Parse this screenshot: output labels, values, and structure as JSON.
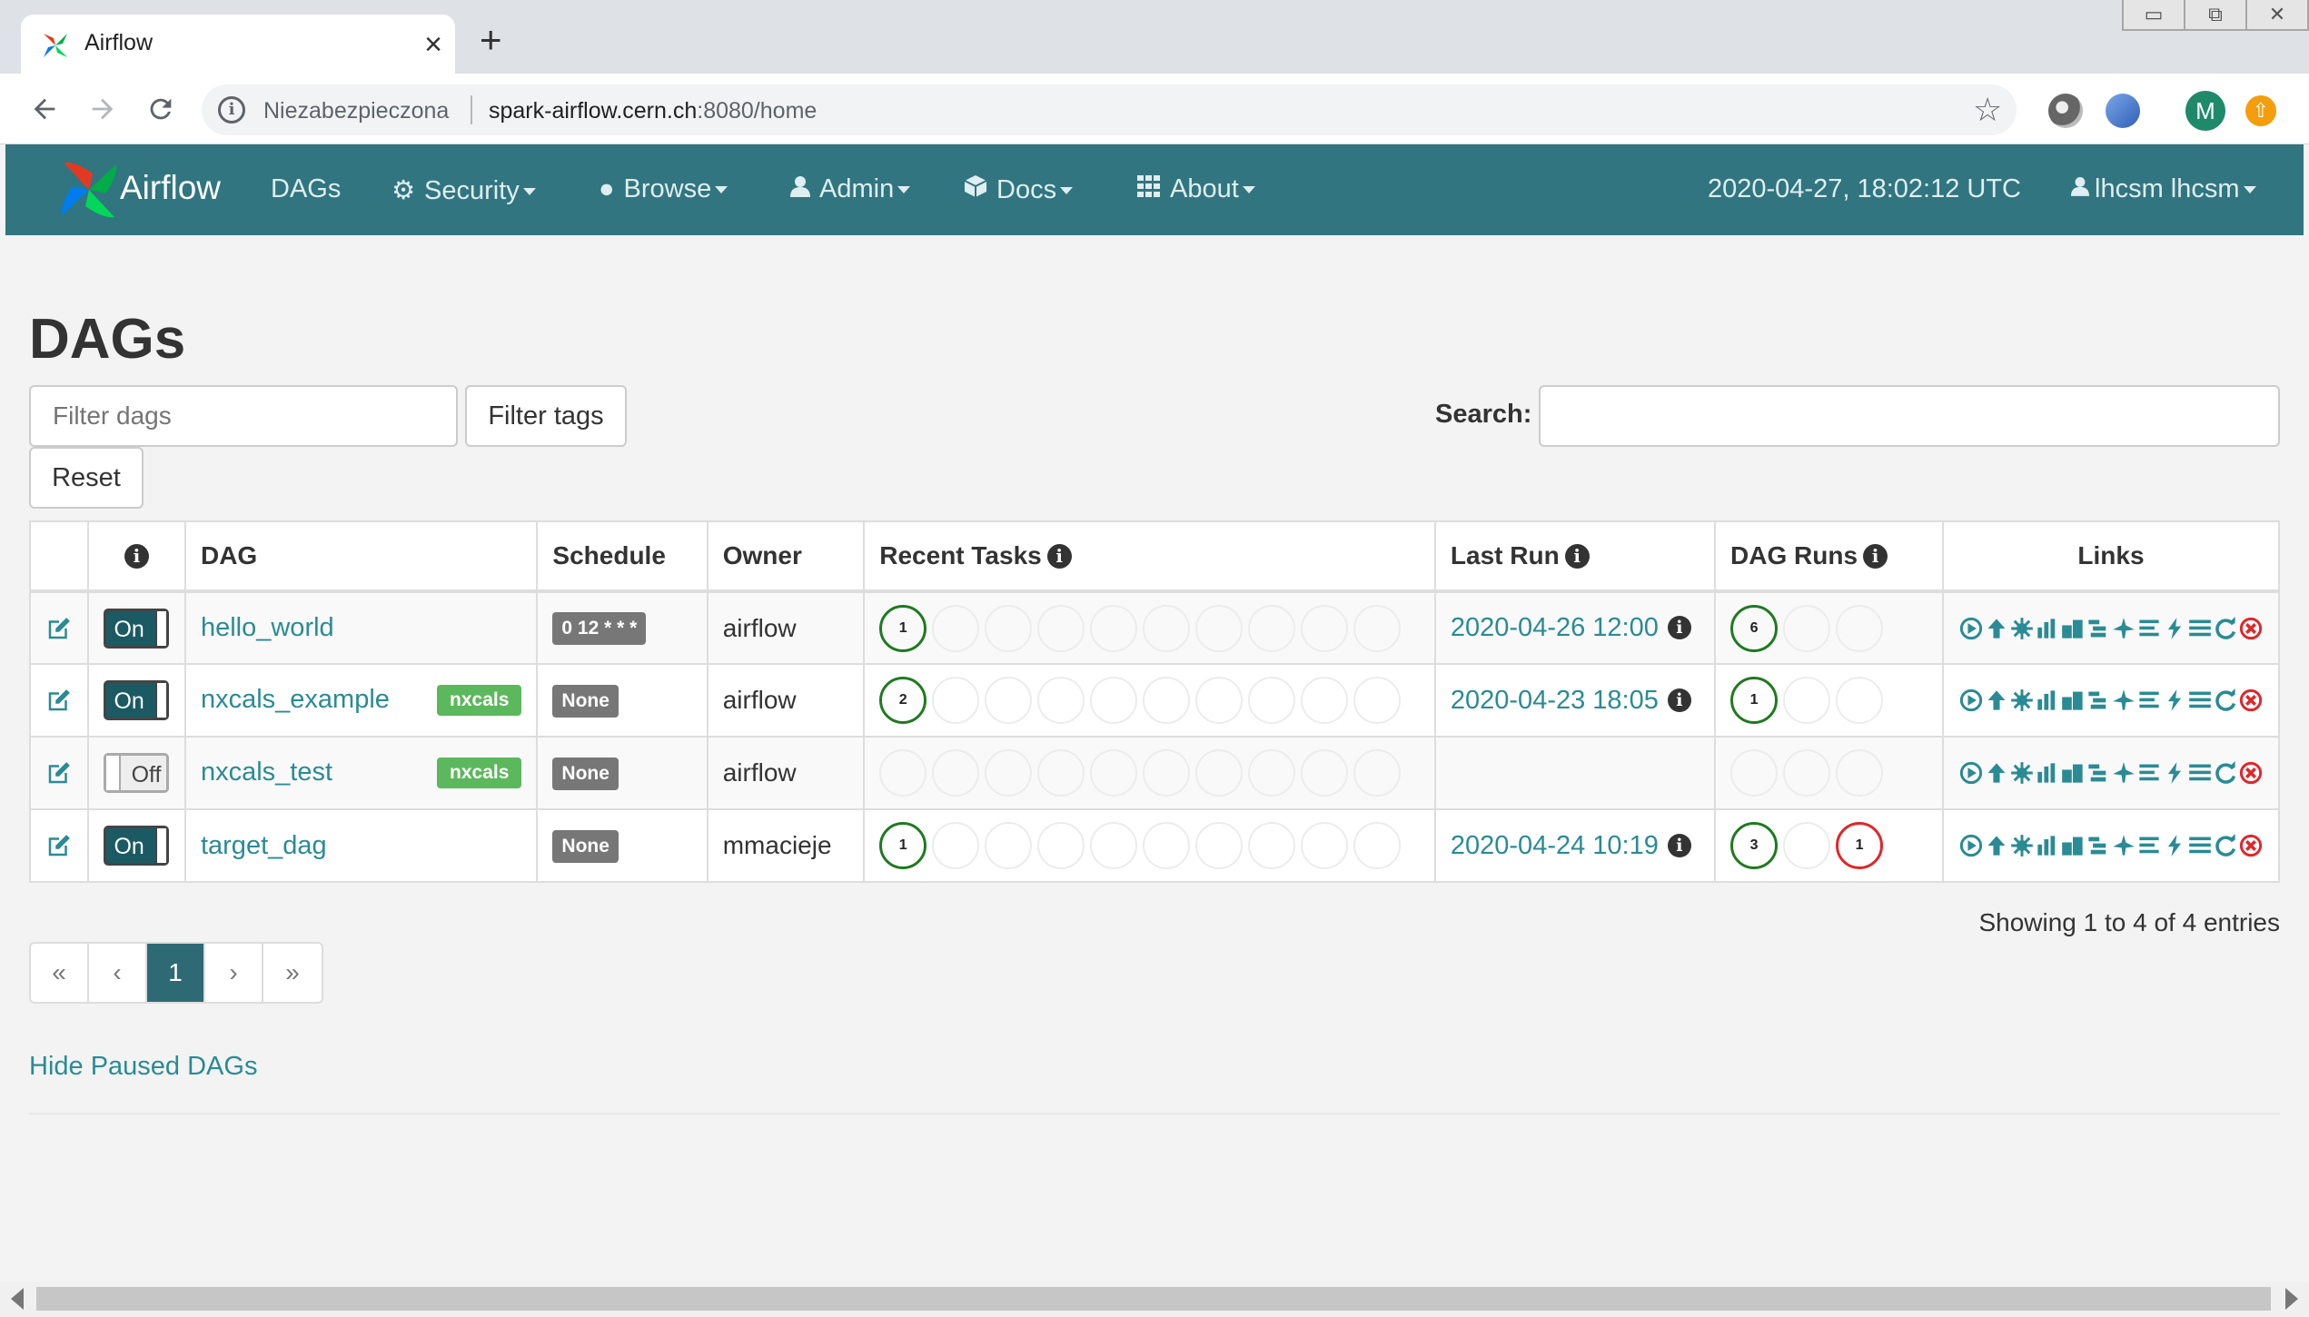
{
  "browser": {
    "tab_title": "Airflow",
    "tab_close": "×",
    "new_tab": "+",
    "window_buttons": [
      "▭",
      "⧉",
      "✕"
    ],
    "security_text": "Niezabezpieczona",
    "url_host": "spark-airflow.cern.ch",
    "url_rest": ":8080/home",
    "profile_initial": "M"
  },
  "navbar": {
    "brand": "Airflow",
    "items": [
      {
        "label": "DAGs",
        "icon": "none",
        "dropdown": false
      },
      {
        "label": "Security",
        "icon": "cogs-icon",
        "dropdown": true
      },
      {
        "label": "Browse",
        "icon": "globe-icon",
        "dropdown": true
      },
      {
        "label": "Admin",
        "icon": "user-icon",
        "dropdown": true
      },
      {
        "label": "Docs",
        "icon": "cube-icon",
        "dropdown": true
      },
      {
        "label": "About",
        "icon": "grid-icon",
        "dropdown": true
      }
    ],
    "time": "2020-04-27, 18:02:12 UTC",
    "user": "lhcsm lhcsm"
  },
  "main": {
    "title": "DAGs",
    "filter_placeholder": "Filter dags",
    "filter_tags_label": "Filter tags",
    "reset_label": "Reset",
    "search_label": "Search:",
    "search_value": "",
    "columns": [
      "",
      "ℹ",
      "DAG",
      "Schedule",
      "Owner",
      "Recent Tasks",
      "Last Run",
      "DAG Runs",
      "Links"
    ],
    "rows": [
      {
        "toggle": "On",
        "dag": "hello_world",
        "tag": "",
        "schedule": "0 12 * * *",
        "owner": "airflow",
        "recent_tasks": [
          "1"
        ],
        "last_run": "2020-04-26 12:00",
        "dag_runs": {
          "success": "6",
          "running": "",
          "failed": ""
        }
      },
      {
        "toggle": "On",
        "dag": "nxcals_example",
        "tag": "nxcals",
        "schedule": "None",
        "owner": "airflow",
        "recent_tasks": [
          "2"
        ],
        "last_run": "2020-04-23 18:05",
        "dag_runs": {
          "success": "1",
          "running": "",
          "failed": ""
        }
      },
      {
        "toggle": "Off",
        "dag": "nxcals_test",
        "tag": "nxcals",
        "schedule": "None",
        "owner": "airflow",
        "recent_tasks": [],
        "last_run": "",
        "dag_runs": {
          "success": "",
          "running": "",
          "failed": ""
        }
      },
      {
        "toggle": "On",
        "dag": "target_dag",
        "tag": "",
        "schedule": "None",
        "owner": "mmacieje",
        "recent_tasks": [
          "1"
        ],
        "last_run": "2020-04-24 10:19",
        "dag_runs": {
          "success": "3",
          "running": "",
          "failed": "1"
        }
      }
    ],
    "link_icons": [
      "play-icon",
      "tree-icon",
      "graph-icon",
      "bar-chart-icon",
      "duration-icon",
      "gantt-icon",
      "landing-icon",
      "tries-icon",
      "code-icon",
      "logs-icon",
      "refresh-icon",
      "delete-icon"
    ],
    "showing_text": "Showing 1 to 4 of 4 entries",
    "pager": [
      "«",
      "‹",
      "1",
      "›",
      "»"
    ],
    "pager_active": "1",
    "hide_paused": "Hide Paused DAGs"
  },
  "colors": {
    "navbar": "#317580",
    "link": "#2a8b94",
    "success": "#1f7a1f",
    "failed": "#e0262a",
    "tag": "#5cb85c"
  }
}
